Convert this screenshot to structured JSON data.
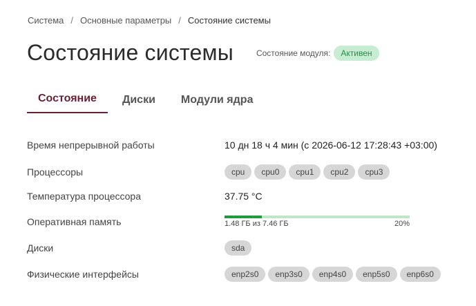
{
  "breadcrumb": {
    "items": [
      "Система",
      "Основные параметры"
    ],
    "current": "Состояние системы",
    "separator": "/"
  },
  "header": {
    "title": "Состояние системы",
    "module_status_label": "Состояние модуля:",
    "module_status_value": "Активен"
  },
  "tabs": [
    {
      "label": "Состояние",
      "active": true
    },
    {
      "label": "Диски",
      "active": false
    },
    {
      "label": "Модули ядра",
      "active": false
    }
  ],
  "info": {
    "uptime": {
      "label": "Время непрерывной работы",
      "value": "10 дн 18 ч 4 мин (с 2026-06-12 17:28:43 +03:00)"
    },
    "cpus": {
      "label": "Процессоры",
      "chips": [
        "cpu",
        "cpu0",
        "cpu1",
        "cpu2",
        "cpu3"
      ]
    },
    "temperature": {
      "label": "Температура процессора",
      "value": "37.75 °C"
    },
    "memory": {
      "label": "Оперативная память",
      "used_text": "1.48 ГБ из 7.46 ГБ",
      "percent_text": "20%",
      "fraction": 0.2
    },
    "disks": {
      "label": "Диски",
      "chips": [
        "sda"
      ]
    },
    "interfaces": {
      "label": "Физические интерфейсы",
      "chips": [
        "enp2s0",
        "enp3s0",
        "enp4s0",
        "enp5s0",
        "enp6s0"
      ]
    }
  },
  "colors": {
    "accent": "#6b1f33",
    "badge_bg": "#c6ecd2",
    "badge_text": "#2a8a4a",
    "bar_fill": "#1f9a3f",
    "bar_track": "#bfe6c8"
  }
}
